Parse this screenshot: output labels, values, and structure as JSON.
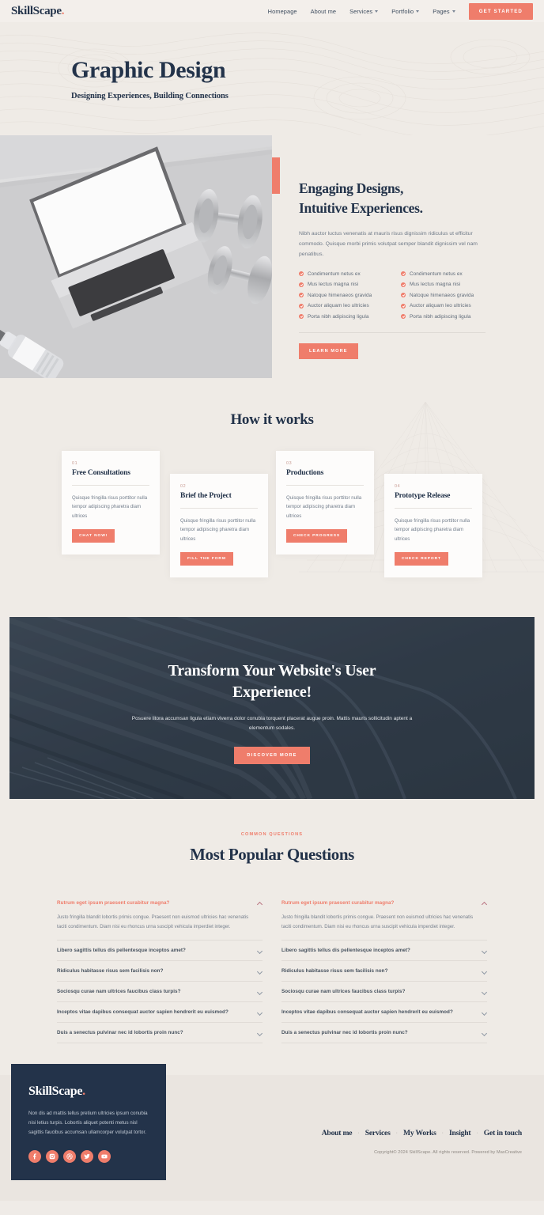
{
  "brand": {
    "name": "SkillScape",
    "dot": "."
  },
  "nav": {
    "items": [
      {
        "label": "Homepage",
        "has_dropdown": false
      },
      {
        "label": "About me",
        "has_dropdown": false
      },
      {
        "label": "Services",
        "has_dropdown": true
      },
      {
        "label": "Portfolio",
        "has_dropdown": true
      },
      {
        "label": "Pages",
        "has_dropdown": true
      }
    ],
    "cta_label": "GET STARTED"
  },
  "hero": {
    "title": "Graphic Design",
    "subtitle": "Designing Experiences, Building Connections"
  },
  "about": {
    "heading_line1": "Engaging Designs,",
    "heading_line2": "Intuitive Experiences.",
    "paragraph": "Nibh auctor luctus venenatis at mauris risus dignissim ridiculus ut efficitur commodo. Quisque morbi primis volutpat semper blandit dignissim vel nam penatibus.",
    "features_left": [
      "Condimentum netus ex",
      "Mus lectus magna nisi",
      "Natoque himenaeos gravida",
      "Auctor aliquam leo ultricies",
      "Porta nibh adipiscing ligula"
    ],
    "features_right": [
      "Condimentum netus ex",
      "Mus lectus magna nisi",
      "Natoque himenaeos gravida",
      "Auctor aliquam leo ultricies",
      "Porta nibh adipiscing ligula"
    ],
    "button_label": "LEARN MORE"
  },
  "works": {
    "title": "How it works",
    "cards": [
      {
        "num": "01",
        "title": "Free Consultations",
        "text": "Quisque fringilla risus porttitor nulla tempor adipiscing pharetra diam ultrices",
        "button": "CHAT NOW!"
      },
      {
        "num": "02",
        "title": "Brief the Project",
        "text": "Quisque fringilla risus porttitor nulla tempor adipiscing pharetra diam ultrices",
        "button": "FILL THE FORM"
      },
      {
        "num": "03",
        "title": "Productions",
        "text": "Quisque fringilla risus porttitor nulla tempor adipiscing pharetra diam ultrices",
        "button": "CHECK PROGRESS"
      },
      {
        "num": "04",
        "title": "Prototype Release",
        "text": "Quisque fringilla risus porttitor nulla tempor adipiscing pharetra diam ultrices",
        "button": "CHECK REPORT"
      }
    ]
  },
  "cta": {
    "title_line1": "Transform Your Website's User",
    "title_line2": "Experience!",
    "paragraph": "Posuere litora accumsan ligula etiam viverra dolor conubia torquent placerat augue proin. Mattis mauris sollicitudin aptent a elementum sodales.",
    "button_label": "DISCOVER MORE"
  },
  "faq": {
    "eyebrow": "COMMON QUESTIONS",
    "title": "Most Popular Questions",
    "answer": "Justo fringilla blandit lobortis primis congue. Praesent non euismod ultricies hac venenatis taciti condimentum. Diam nisi eu rhoncus urna suscipit vehicula imperdiet integer.",
    "left": [
      {
        "q": "Rutrum eget ipsum praesent curabitur magna?",
        "open": true
      },
      {
        "q": "Libero sagittis tellus dis pellentesque inceptos amet?",
        "open": false
      },
      {
        "q": "Ridiculus habitasse risus sem facilisis non?",
        "open": false
      },
      {
        "q": "Sociosqu curae nam ultrices faucibus class turpis?",
        "open": false
      },
      {
        "q": "Inceptos vitae dapibus consequat auctor sapien hendrerit eu euismod?",
        "open": false
      },
      {
        "q": "Duis a senectus pulvinar nec id lobortis proin nunc?",
        "open": false
      }
    ],
    "right": [
      {
        "q": "Rutrum eget ipsum praesent curabitur magna?",
        "open": true
      },
      {
        "q": "Libero sagittis tellus dis pellentesque inceptos amet?",
        "open": false
      },
      {
        "q": "Ridiculus habitasse risus sem facilisis non?",
        "open": false
      },
      {
        "q": "Sociosqu curae nam ultrices faucibus class turpis?",
        "open": false
      },
      {
        "q": "Inceptos vitae dapibus consequat auctor sapien hendrerit eu euismod?",
        "open": false
      },
      {
        "q": "Duis a senectus pulvinar nec id lobortis proin nunc?",
        "open": false
      }
    ]
  },
  "footer": {
    "brand": "SkillScape",
    "dot": ".",
    "about": "Non dis ad mattis tellus pretium ultricies ipsum conubia nisi letius turpis. Lobortis aliquet potenti metus nisl sagittis faucibus accumsan ullamcorper volutpat tortor.",
    "socials": [
      "facebook-icon",
      "instagram-icon",
      "dribbble-icon",
      "twitter-icon",
      "youtube-icon"
    ],
    "links": [
      "About me",
      "Services",
      "My Works",
      "Insight",
      "Get in touch"
    ],
    "separator": "·",
    "copyright": "Copyright© 2024 SkillScape. All rights reserved. Powered by MaxCreative"
  },
  "colors": {
    "accent": "#ef7d6b",
    "dark": "#23334a",
    "background": "#efebe6",
    "card": "#fdfcfb"
  }
}
